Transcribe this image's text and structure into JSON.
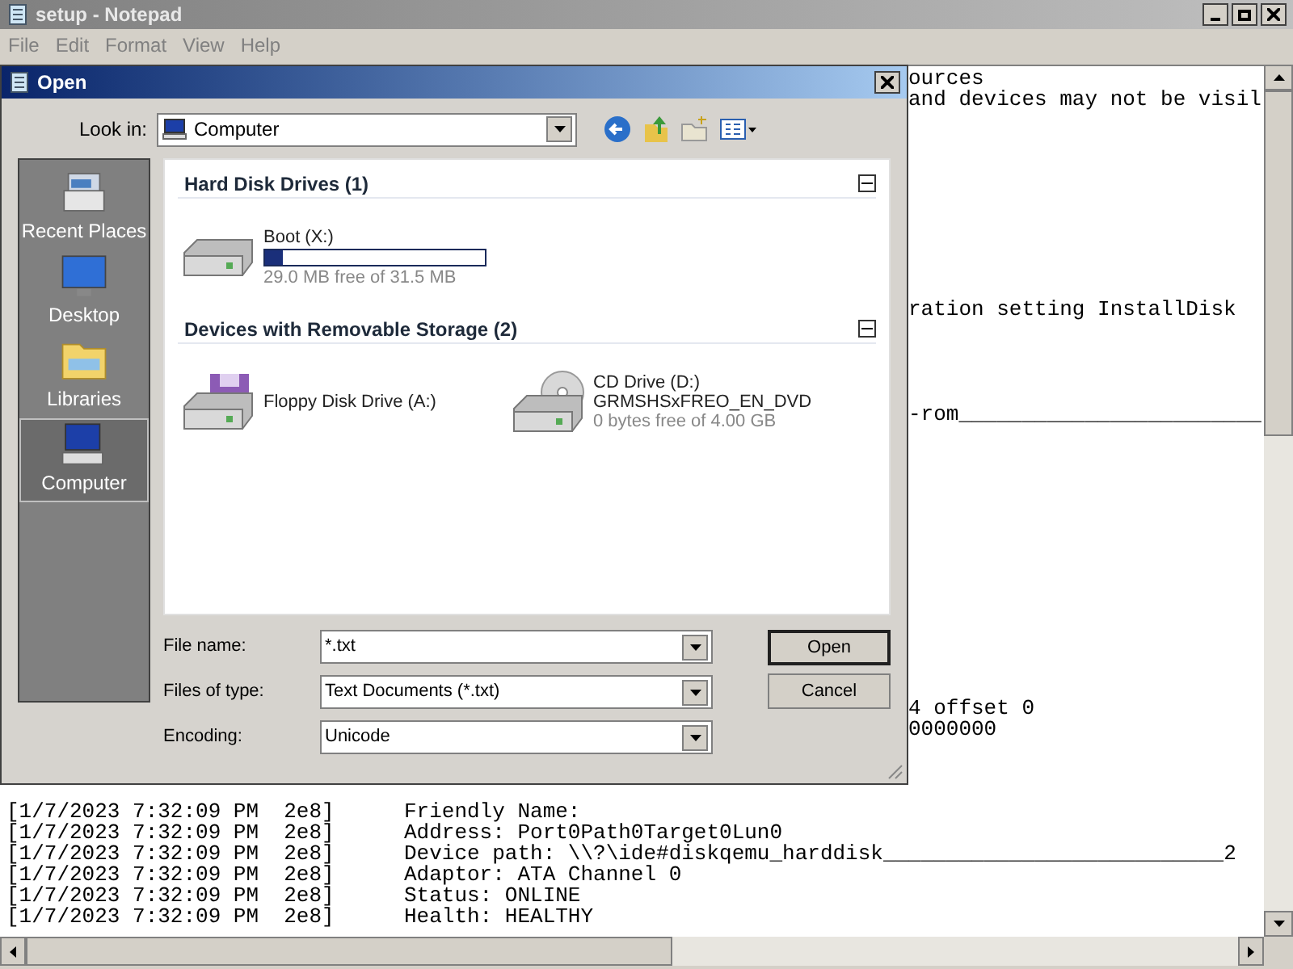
{
  "notepad": {
    "title": "setup - Notepad",
    "menu": [
      "File",
      "Edit",
      "Format",
      "View",
      "Help"
    ],
    "right_fragments": [
      [
        "ources",
        "and devices may not be visil"
      ],
      [
        "ration setting InstallDisk"
      ],
      [
        "-rom________________________"
      ],
      [
        "4 offset 0",
        "0000000"
      ]
    ],
    "log_lines": [
      {
        "prefix": "[1/7/2023 7:32:09 PM  2e8]",
        "message": "Friendly Name:"
      },
      {
        "prefix": "[1/7/2023 7:32:09 PM  2e8]",
        "message": "Address: Port0Path0Target0Lun0"
      },
      {
        "prefix": "[1/7/2023 7:32:09 PM  2e8]",
        "message": "Device path: \\\\?\\ide#diskqemu_harddisk___________________________2"
      },
      {
        "prefix": "[1/7/2023 7:32:09 PM  2e8]",
        "message": "Adaptor: ATA Channel 0"
      },
      {
        "prefix": "[1/7/2023 7:32:09 PM  2e8]",
        "message": "Status: ONLINE"
      },
      {
        "prefix": "[1/7/2023 7:32:09 PM  2e8]",
        "message": "Health: HEALTHY"
      }
    ]
  },
  "dialog": {
    "title": "Open",
    "look_in": {
      "label": "Look in:",
      "value": "Computer"
    },
    "places": [
      {
        "kind": "recent",
        "label": "Recent Places",
        "selected": false
      },
      {
        "kind": "desktop",
        "label": "Desktop",
        "selected": false
      },
      {
        "kind": "libraries",
        "label": "Libraries",
        "selected": false
      },
      {
        "kind": "computer",
        "label": "Computer",
        "selected": true
      }
    ],
    "groups": [
      {
        "title": "Hard Disk Drives (1)",
        "expanded": true,
        "drives": [
          {
            "kind": "hdd",
            "name": "Boot (X:)",
            "level": 0.08,
            "free": "29.0 MB free of 31.5 MB"
          }
        ]
      },
      {
        "title": "Devices with Removable Storage (2)",
        "expanded": true,
        "drives": [
          {
            "kind": "floppy",
            "name": "Floppy Disk Drive (A:)"
          },
          {
            "kind": "cd",
            "name": "CD Drive (D:)",
            "volume": "GRMSHSxFREO_EN_DVD",
            "free": "0 bytes free of 4.00 GB"
          }
        ]
      }
    ],
    "fields": [
      {
        "label": "File name:",
        "value": "*.txt"
      },
      {
        "label": "Files of type:",
        "value": "Text Documents (*.txt)"
      },
      {
        "label": "Encoding:",
        "value": "Unicode"
      }
    ],
    "buttons": [
      {
        "label": "Open",
        "default": true
      },
      {
        "label": "Cancel",
        "default": false
      }
    ]
  }
}
